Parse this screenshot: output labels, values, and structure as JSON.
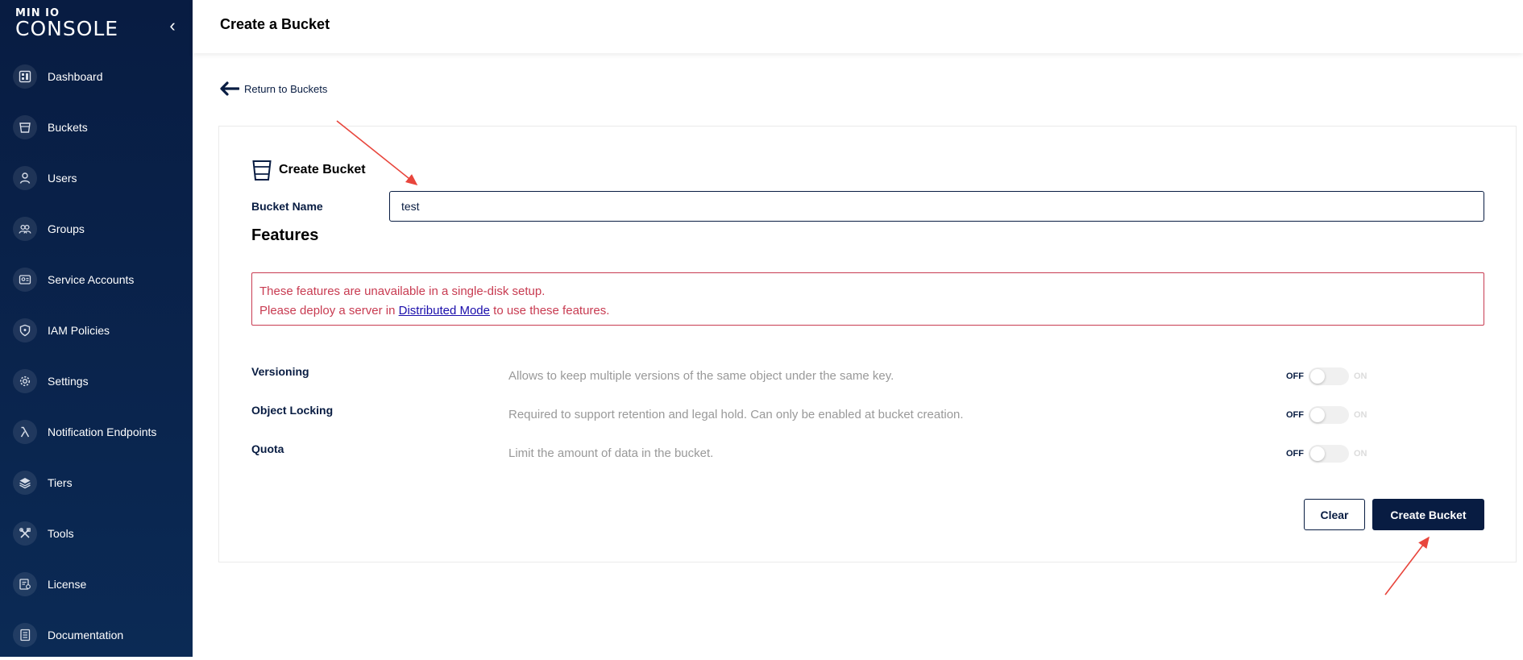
{
  "sidebar": {
    "logo_small": "MIN IO",
    "logo_big": "CONSOLE",
    "items": [
      {
        "label": "Dashboard",
        "icon": "dashboard-icon"
      },
      {
        "label": "Buckets",
        "icon": "bucket-icon"
      },
      {
        "label": "Users",
        "icon": "user-icon"
      },
      {
        "label": "Groups",
        "icon": "groups-icon"
      },
      {
        "label": "Service Accounts",
        "icon": "service-accounts-icon"
      },
      {
        "label": "IAM Policies",
        "icon": "shield-icon"
      },
      {
        "label": "Settings",
        "icon": "gear-icon"
      },
      {
        "label": "Notification Endpoints",
        "icon": "lambda-icon"
      },
      {
        "label": "Tiers",
        "icon": "layers-icon"
      },
      {
        "label": "Tools",
        "icon": "tools-icon"
      },
      {
        "label": "License",
        "icon": "license-icon"
      },
      {
        "label": "Documentation",
        "icon": "document-icon"
      }
    ]
  },
  "header": {
    "title": "Create a Bucket"
  },
  "back_link": {
    "label": "Return to Buckets"
  },
  "form": {
    "title": "Create Bucket",
    "bucket_name_label": "Bucket Name",
    "bucket_name_value": "test",
    "features_title": "Features",
    "warning_line1": "These features are unavailable in a single-disk setup.",
    "warning_line2_pre": "Please deploy a server in ",
    "warning_link": "Distributed Mode",
    "warning_line2_post": " to use these features.",
    "features": [
      {
        "name": "Versioning",
        "description": "Allows to keep multiple versions of the same object under the same key.",
        "off_label": "OFF",
        "on_label": "ON",
        "state": false
      },
      {
        "name": "Object Locking",
        "description": "Required to support retention and legal hold. Can only be enabled at bucket creation.",
        "off_label": "OFF",
        "on_label": "ON",
        "state": false
      },
      {
        "name": "Quota",
        "description": "Limit the amount of data in the bucket.",
        "off_label": "OFF",
        "on_label": "ON",
        "state": false
      }
    ],
    "clear_label": "Clear",
    "create_label": "Create Bucket"
  },
  "colors": {
    "sidebar_bg": "#081c42",
    "primary": "#081c42",
    "warning": "#c83b51",
    "annotation_arrow": "#e8453c"
  }
}
